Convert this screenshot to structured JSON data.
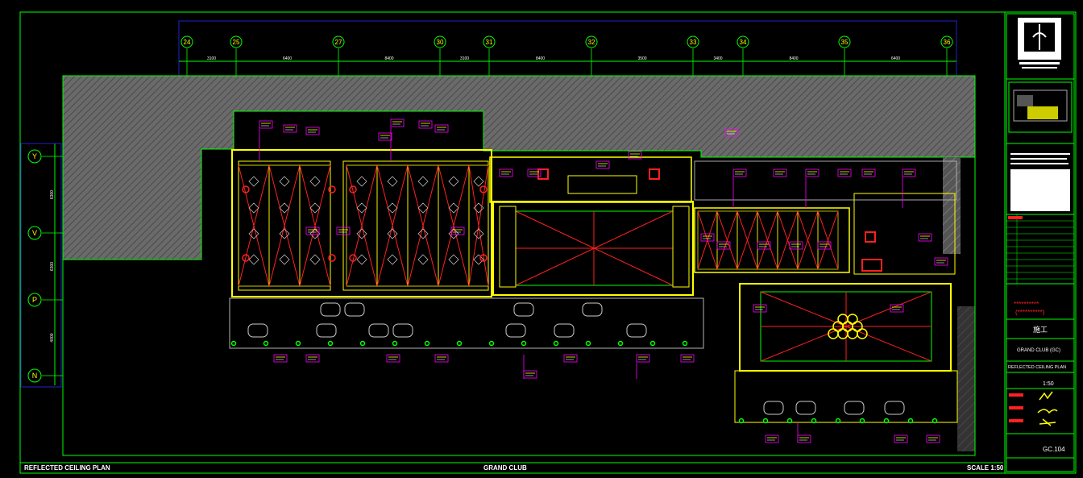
{
  "footer": {
    "plan_title": "REFLECTED CEILING PLAN",
    "area_title": "GRAND CLUB",
    "scale": "SCALE 1:50"
  },
  "grid": {
    "columns": [
      "24",
      "25",
      "27",
      "30",
      "31",
      "32",
      "33",
      "34",
      "35",
      "36"
    ],
    "column_spacings": [
      "3100",
      "6400",
      "8400",
      "3100",
      "8400",
      "3500",
      "3400",
      "8400",
      "6400"
    ],
    "rows": [
      "Y",
      "V",
      "P",
      "N"
    ],
    "row_spacings": [
      "6300",
      "6300",
      "4000"
    ]
  },
  "title_block": {
    "project_name_line1": "**********",
    "project_name_line2": "(**********)",
    "status": "施工",
    "area": "GRAND CLUB (GC)",
    "drawing_title": "REFLECTED CEILING PLAN",
    "scale_value": "1:50",
    "drawing_number": "GC.104"
  },
  "colors": {
    "background": "#000000",
    "border": "#00ff00",
    "frame": "#2222cc",
    "wall": "#ffff00",
    "light": "#ff2020",
    "tag": "#ff00ff",
    "hatch": "#6e6e6e",
    "text": "#ffffff"
  }
}
